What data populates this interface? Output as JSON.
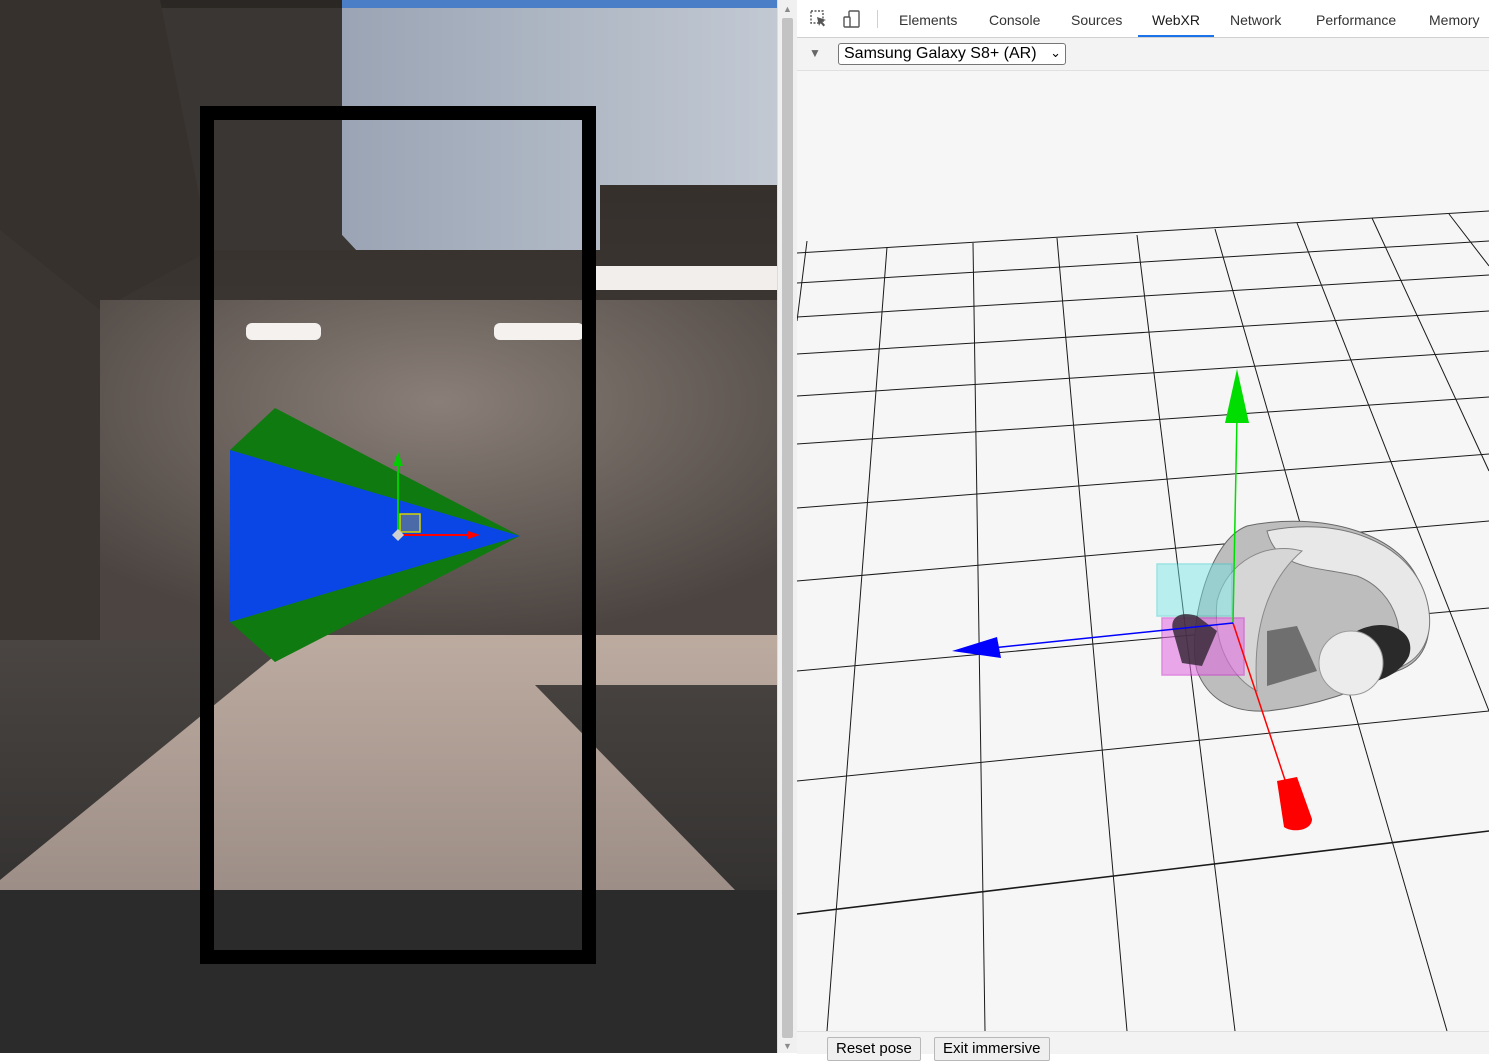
{
  "toolbar": {
    "icons": [
      "inspect-element-icon",
      "device-toolbar-icon"
    ],
    "tabs": [
      {
        "label": "Elements"
      },
      {
        "label": "Console"
      },
      {
        "label": "Sources"
      },
      {
        "label": "WebXR"
      },
      {
        "label": "Network"
      },
      {
        "label": "Performance"
      },
      {
        "label": "Memory"
      }
    ],
    "active_tab": "WebXR"
  },
  "webxr": {
    "device": "Samsung Galaxy S8+ (AR)"
  },
  "buttons": {
    "reset_pose": "Reset pose",
    "exit_immersive": "Exit immersive"
  },
  "colors": {
    "accent": "#1a73e8",
    "axis_x": "#ff0000",
    "axis_y": "#00dd00",
    "axis_z": "#0000ff",
    "cone_outer": "#0f7a0f",
    "cone_inner": "#0a46e6"
  }
}
